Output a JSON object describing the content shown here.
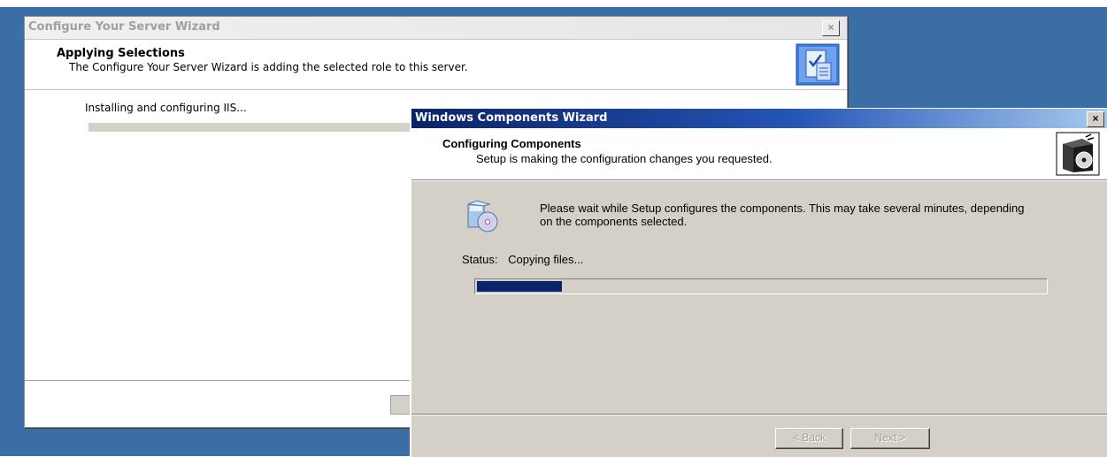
{
  "server_wizard": {
    "title": "Configure Your Server Wizard",
    "close_label": "×",
    "header_title": "Applying Selections",
    "header_subtitle": "The Configure Your Server Wizard is adding the selected role to this server.",
    "header_icon": "checklist-icon",
    "body_text": "Installing and configuring IIS..."
  },
  "components_wizard": {
    "title": "Windows Components Wizard",
    "close_label": "×",
    "header_title": "Configuring Components",
    "header_subtitle": "Setup is making the configuration changes you requested.",
    "header_icon": "software-box-icon",
    "wait_icon": "setup-disc-icon",
    "wait_message": "Please wait while Setup configures the components. This may take several minutes, depending on the components selected.",
    "status_label": "Status:",
    "status_value": "Copying files...",
    "progress_fraction": 0.15,
    "buttons": {
      "back": "< Back",
      "next": "Next >"
    }
  },
  "colors": {
    "desktop": "#3a6ea5",
    "title_active": "#0a246a",
    "progress_fill": "#0a246a",
    "dialog_face": "#d4d0c8"
  }
}
